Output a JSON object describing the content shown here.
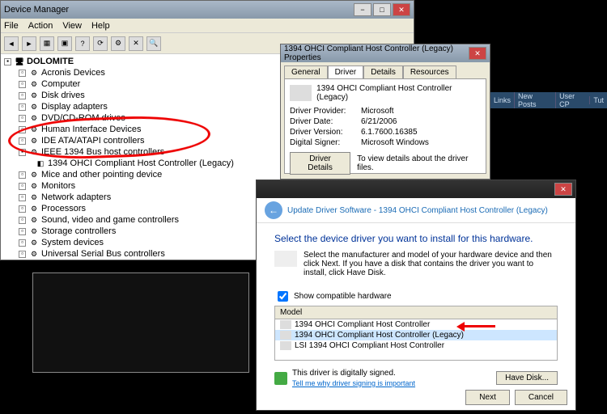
{
  "dm": {
    "title": "Device Manager",
    "menu": [
      "File",
      "Action",
      "View",
      "Help"
    ],
    "root": "DOLOMITE",
    "nodes": [
      {
        "label": "Acronis Devices"
      },
      {
        "label": "Computer"
      },
      {
        "label": "Disk drives"
      },
      {
        "label": "Display adapters"
      },
      {
        "label": "DVD/CD-ROM drives"
      },
      {
        "label": "Human Interface Devices"
      },
      {
        "label": "IDE ATA/ATAPI controllers"
      },
      {
        "label": "IEEE 1394 Bus host controllers",
        "expanded": true,
        "highlight": true
      },
      {
        "label": "Mice and other pointing device"
      },
      {
        "label": "Monitors"
      },
      {
        "label": "Network adapters"
      },
      {
        "label": "Processors"
      },
      {
        "label": "Sound, video and game controllers"
      },
      {
        "label": "Storage controllers"
      },
      {
        "label": "System devices"
      },
      {
        "label": "Universal Serial Bus controllers"
      }
    ],
    "child1394": "1394 OHCI Compliant Host Controller (Legacy)"
  },
  "props": {
    "title": "1394 OHCI Compliant Host Controller (Legacy) Properties",
    "tabs": [
      "General",
      "Driver",
      "Details",
      "Resources"
    ],
    "device_name": "1394 OHCI Compliant Host Controller (Legacy)",
    "fields": {
      "provider_label": "Driver Provider:",
      "provider": "Microsoft",
      "date_label": "Driver Date:",
      "date": "6/21/2006",
      "version_label": "Driver Version:",
      "version": "6.1.7600.16385",
      "signer_label": "Digital Signer:",
      "signer": "Microsoft Windows"
    },
    "driver_details_btn": "Driver Details",
    "driver_details_text": "To view details about the driver files."
  },
  "upd": {
    "header": "Update Driver Software - 1394 OHCI Compliant Host Controller (Legacy)",
    "h1": "Select the device driver you want to install for this hardware.",
    "instructions": "Select the manufacturer and model of your hardware device and then click Next. If you have a disk that contains the driver you want to install, click Have Disk.",
    "show_compat": "Show compatible hardware",
    "model_hdr": "Model",
    "models": [
      "1394 OHCI Compliant Host Controller",
      "1394 OHCI Compliant Host Controller (Legacy)",
      "LSI 1394 OHCI Compliant Host Controller"
    ],
    "signed": "This driver is digitally signed.",
    "signing_link": "Tell me why driver signing is important",
    "have_disk": "Have Disk...",
    "next": "Next",
    "cancel": "Cancel"
  },
  "forum": {
    "links": "Links",
    "new_posts": "New Posts",
    "user_cp": "User CP",
    "tut": "Tut"
  }
}
